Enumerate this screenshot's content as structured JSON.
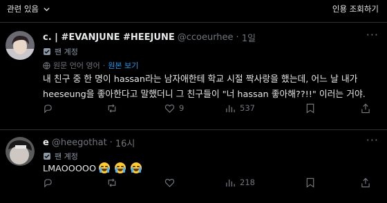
{
  "topbar": {
    "sort_label": "관련 있음",
    "quotes_link": "인용 조회하기"
  },
  "tweets": [
    {
      "display_name": "c. | #EVANJUNE #HEEJUNE",
      "handle": "@ccoeurhee",
      "separator": "·",
      "time": "1일",
      "badge": "팬 계정",
      "translate_text": "원문 언어 영어",
      "translate_link": "원본 보기",
      "text_line1": "내 친구 중 한 명이 hassan라는 남자애한테 학교 시절 짝사랑을 했는데, 어느 날 내가",
      "text_line2": "heeseung을 좋아한다고 말했더니 그 친구들이 \"너 hassan 좋아해??!!\" 이러는 거야.",
      "replies": "",
      "retweets": "",
      "likes": "9",
      "views": "537"
    },
    {
      "display_name": "e",
      "handle": "@heegothat",
      "separator": "·",
      "time": "16시",
      "badge": "팬 계정",
      "text": "LMAOOOOO",
      "emojis": [
        "loudly-crying-face",
        "loudly-crying-face",
        "loudly-crying-face"
      ],
      "replies": "",
      "retweets": "",
      "likes": "",
      "views": "218"
    }
  ],
  "colors": {
    "background": "#000000",
    "text": "#e7e9ea",
    "muted": "#71767b",
    "link": "#1d9bf0",
    "divider": "#2f3336"
  }
}
